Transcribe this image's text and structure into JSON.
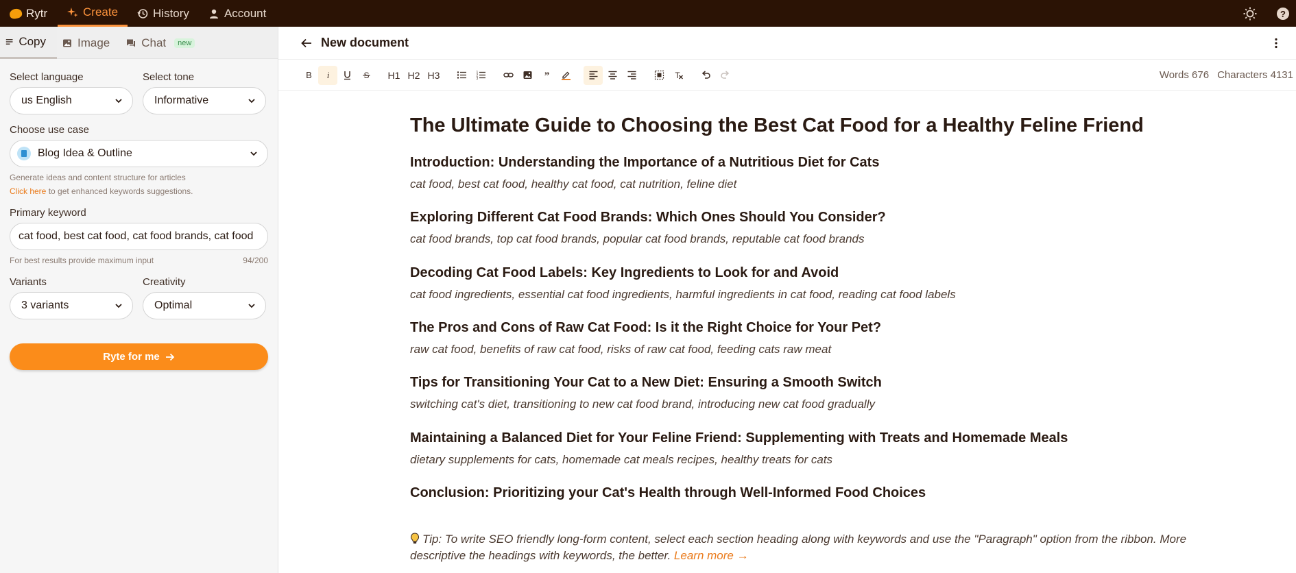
{
  "topbar": {
    "brand": "Rytr",
    "nav": [
      {
        "label": "Create",
        "icon": "sparkle-icon",
        "active": true
      },
      {
        "label": "History",
        "icon": "history-icon",
        "active": false
      },
      {
        "label": "Account",
        "icon": "user-icon",
        "active": false
      }
    ],
    "icons": [
      "sun-icon",
      "help-icon"
    ]
  },
  "sidebar": {
    "tabs": [
      {
        "label": "Copy",
        "icon": "lines-icon"
      },
      {
        "label": "Image",
        "icon": "image-icon"
      },
      {
        "label": "Chat",
        "icon": "chat-icon",
        "badge": "new"
      }
    ],
    "language": {
      "label": "Select language",
      "value": "us English"
    },
    "tone": {
      "label": "Select tone",
      "value": "Informative"
    },
    "use_case": {
      "label": "Choose use case",
      "value": "Blog Idea & Outline"
    },
    "use_case_help": "Generate ideas and content structure for articles",
    "keywords_link": "Click here",
    "keywords_help": " to get enhanced keywords suggestions.",
    "primary_keyword": {
      "label": "Primary keyword",
      "value": "cat food, best cat food, cat food brands, cat food",
      "helper": "For best results provide maximum input",
      "counter": "94/200"
    },
    "variants": {
      "label": "Variants",
      "value": "3 variants"
    },
    "creativity": {
      "label": "Creativity",
      "value": "Optimal"
    },
    "submit": "Ryte for me"
  },
  "editor": {
    "title": "New document",
    "toolbar": {
      "headings": [
        "H1",
        "H2",
        "H3"
      ],
      "words_label": "Words 676",
      "chars_label": "Characters 4131"
    },
    "doc_title": "The Ultimate Guide to Choosing the Best Cat Food for a Healthy Feline Friend",
    "sections": [
      {
        "heading": "Introduction: Understanding the Importance of a Nutritious Diet for Cats",
        "keywords": "cat food, best cat food, healthy cat food, cat nutrition, feline diet"
      },
      {
        "heading": "Exploring Different Cat Food Brands: Which Ones Should You Consider?",
        "keywords": "cat food brands, top cat food brands, popular cat food brands, reputable cat food brands"
      },
      {
        "heading": "Decoding Cat Food Labels: Key Ingredients to Look for and Avoid",
        "keywords": "cat food ingredients, essential cat food ingredients, harmful ingredients in cat food, reading cat food labels"
      },
      {
        "heading": "The Pros and Cons of Raw Cat Food: Is it the Right Choice for Your Pet?",
        "keywords": "raw cat food, benefits of raw cat food, risks of raw cat food, feeding cats raw meat"
      },
      {
        "heading": "Tips for Transitioning Your Cat to a New Diet: Ensuring a Smooth Switch",
        "keywords": "switching cat's diet, transitioning to new cat food brand, introducing new cat food gradually"
      },
      {
        "heading": "Maintaining a Balanced Diet for Your Feline Friend: Supplementing with Treats and Homemade Meals",
        "keywords": "dietary supplements for cats, homemade cat meals recipes, healthy treats for cats"
      },
      {
        "heading": "Conclusion: Prioritizing your Cat's Health through Well-Informed Food Choices"
      }
    ],
    "tip": "Tip: To write SEO friendly long-form content, select each section heading along with keywords and use the \"Paragraph\" option from the ribbon. More descriptive the headings with keywords, the better. ",
    "tip_link": "Learn more →",
    "dash": "—"
  },
  "colors": {
    "topbar": "#2b1305",
    "accent": "#fb8c1a"
  }
}
